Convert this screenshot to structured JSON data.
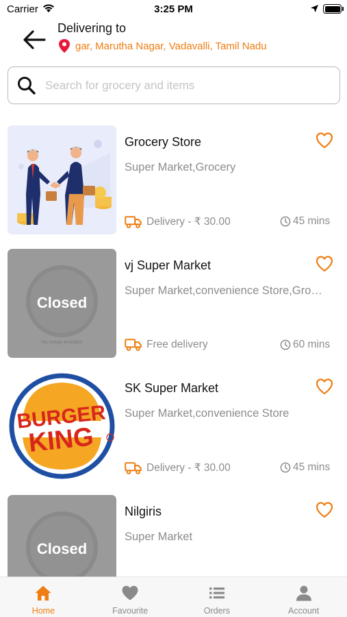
{
  "status_bar": {
    "carrier": "Carrier",
    "time": "3:25 PM"
  },
  "header": {
    "title": "Delivering to",
    "address": "gar, Marutha Nagar, Vadavalli, Tamil Nadu"
  },
  "search": {
    "placeholder": "Search for grocery and items",
    "value": ""
  },
  "theme": {
    "accent": "#ee7d12",
    "pin": "#e8183a",
    "muted": "#8c8c8c"
  },
  "stores": [
    {
      "name": "Grocery Store",
      "categories": "Super Market,Grocery",
      "delivery": "Delivery - ₹ 30.00",
      "time": "45 mins",
      "image": "business-handshake-illustration",
      "closed": false
    },
    {
      "name": "vj Super Market",
      "categories": "Super Market,convenience Store,Gro…",
      "delivery": "Free delivery",
      "time": "60 mins",
      "image": "no-image-placeholder",
      "closed": true,
      "closed_label": "Closed",
      "placeholder_caption": "No image available"
    },
    {
      "name": "SK Super Market",
      "categories": "Super Market,convenience Store",
      "delivery": "Delivery - ₹ 30.00",
      "time": "45 mins",
      "image": "burger-king-logo",
      "closed": false,
      "logo_text_top": "BURGER",
      "logo_text_bottom": "KING"
    },
    {
      "name": "Nilgiris",
      "categories": "Super Market",
      "image": "no-image-placeholder",
      "closed": true,
      "closed_label": "Closed"
    }
  ],
  "tabs": [
    {
      "label": "Home",
      "icon": "home-icon",
      "active": true
    },
    {
      "label": "Favourite",
      "icon": "heart-icon",
      "active": false
    },
    {
      "label": "Orders",
      "icon": "list-icon",
      "active": false
    },
    {
      "label": "Account",
      "icon": "person-icon",
      "active": false
    }
  ]
}
